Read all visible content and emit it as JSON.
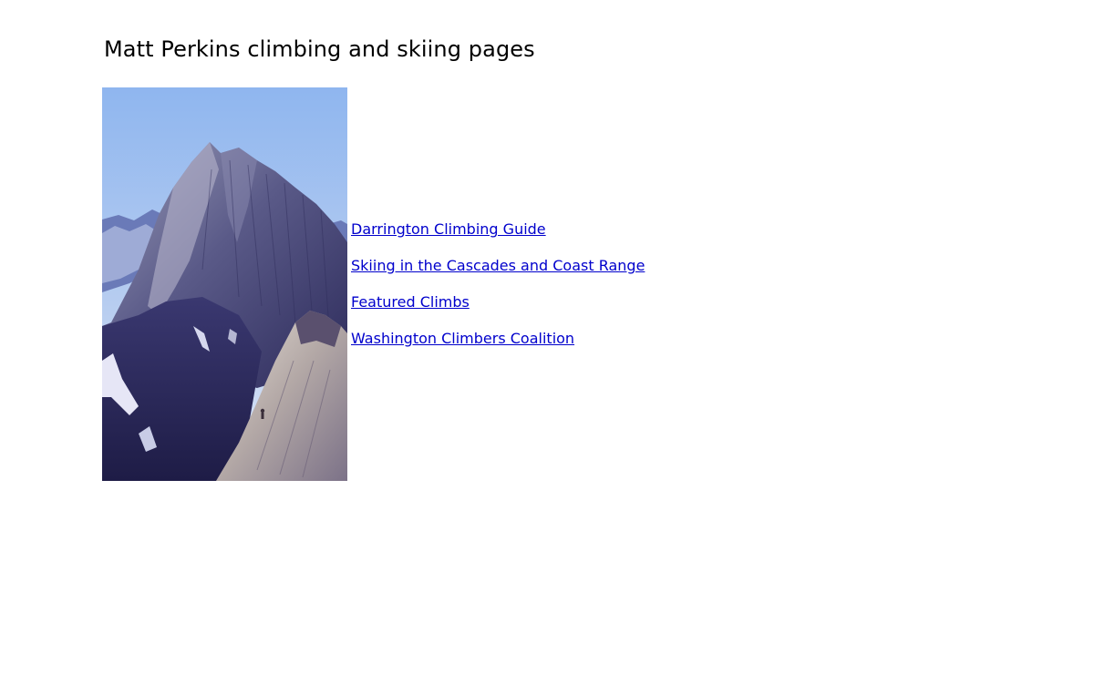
{
  "page": {
    "title": "Matt Perkins climbing and skiing pages"
  },
  "photo": {
    "alt": "Granite peak with climber on a ridge"
  },
  "links": [
    {
      "label": "Darrington Climbing Guide"
    },
    {
      "label": "Skiing in the Cascades and Coast Range"
    },
    {
      "label": "Featured Climbs"
    },
    {
      "label": "Washington Climbers Coalition"
    }
  ],
  "colors": {
    "link": "#0000cc",
    "text": "#000000",
    "background": "#ffffff"
  }
}
